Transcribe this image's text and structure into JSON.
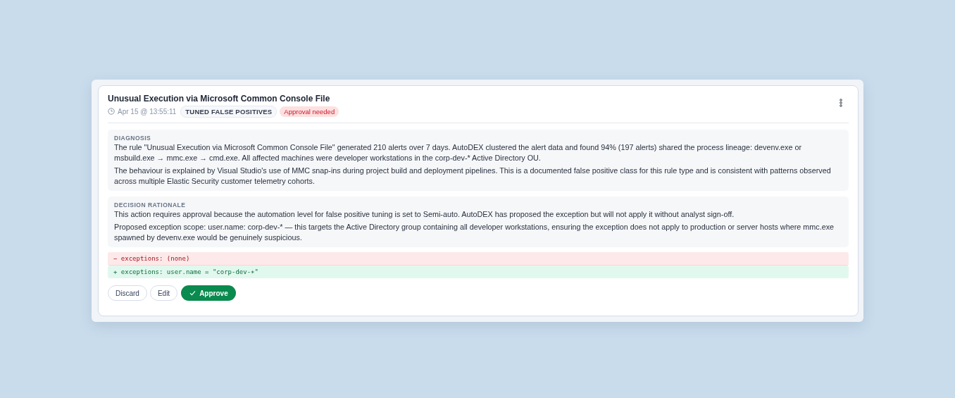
{
  "card": {
    "title": "Unusual Execution via Microsoft Common Console File",
    "timestamp": "Apr 15 @ 13:55:11",
    "tags": [
      {
        "label": "TUNED FALSE POSITIVES",
        "kind": "category"
      },
      {
        "label": "Approval needed",
        "kind": "warning"
      }
    ],
    "sections": [
      {
        "heading": "DIAGNOSIS",
        "paragraphs": [
          "The rule \"Unusual Execution via Microsoft Common Console File\" generated 210 alerts over 7 days. AutoDEX clustered the alert data and found 94% (197 alerts) shared the process lineage: devenv.exe or msbuild.exe → mmc.exe → cmd.exe. All affected machines were developer workstations in the corp-dev-* Active Directory OU.",
          "The behaviour is explained by Visual Studio's use of MMC snap-ins during project build and deployment pipelines. This is a documented false positive class for this rule type and is consistent with patterns observed across multiple Elastic Security customer telemetry cohorts."
        ]
      },
      {
        "heading": "DECISION RATIONALE",
        "paragraphs": [
          "This action requires approval because the automation level for false positive tuning is set to Semi-auto. AutoDEX has proposed the exception but will not apply it without analyst sign-off.",
          "Proposed exception scope: user.name: corp-dev-* — this targets the Active Directory group containing all developer workstations, ensuring the exception does not apply to production or server hosts where mmc.exe spawned by devenv.exe would be genuinely suspicious."
        ]
      }
    ],
    "diff": [
      {
        "kind": "removed",
        "text": "− exceptions: (none)"
      },
      {
        "kind": "added",
        "text": "+ exceptions: user.name = \"corp-dev-∗\""
      }
    ],
    "actions": [
      {
        "label": "Discard",
        "kind": "secondary"
      },
      {
        "label": "Edit",
        "kind": "secondary"
      },
      {
        "label": "Approve",
        "kind": "primary"
      }
    ]
  }
}
